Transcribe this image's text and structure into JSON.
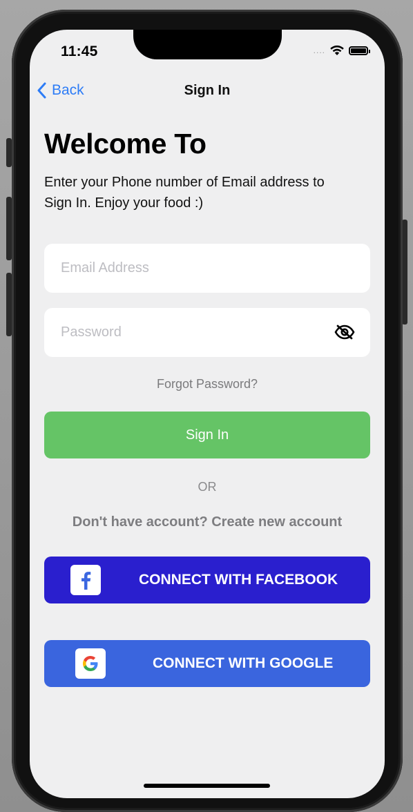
{
  "status_bar": {
    "time": "11:45",
    "signal_dots": "....",
    "icons": [
      "wifi-icon",
      "battery-icon"
    ]
  },
  "navbar": {
    "back_label": "Back",
    "title": "Sign In"
  },
  "content": {
    "heading": "Welcome To",
    "subtitle": "Enter your Phone number of Email address to Sign In. Enjoy your food :)"
  },
  "form": {
    "email_placeholder": "Email Address",
    "email_value": "",
    "password_placeholder": "Password",
    "password_value": "",
    "password_toggle_icon": "eye-slash-icon",
    "forgot_label": "Forgot Password?",
    "signin_label": "Sign In",
    "or_label": "OR",
    "create_account_label": "Don't have account? Create new account"
  },
  "social": {
    "facebook_label": "CONNECT WITH FACEBOOK",
    "facebook_icon": "facebook-icon",
    "google_label": "CONNECT WITH GOOGLE",
    "google_icon": "google-icon"
  },
  "colors": {
    "accent_blue": "#2d7cf6",
    "signin_green": "#65c466",
    "facebook_bg": "#2a1fce",
    "google_bg": "#3a65de",
    "screen_bg": "#efeff0"
  }
}
